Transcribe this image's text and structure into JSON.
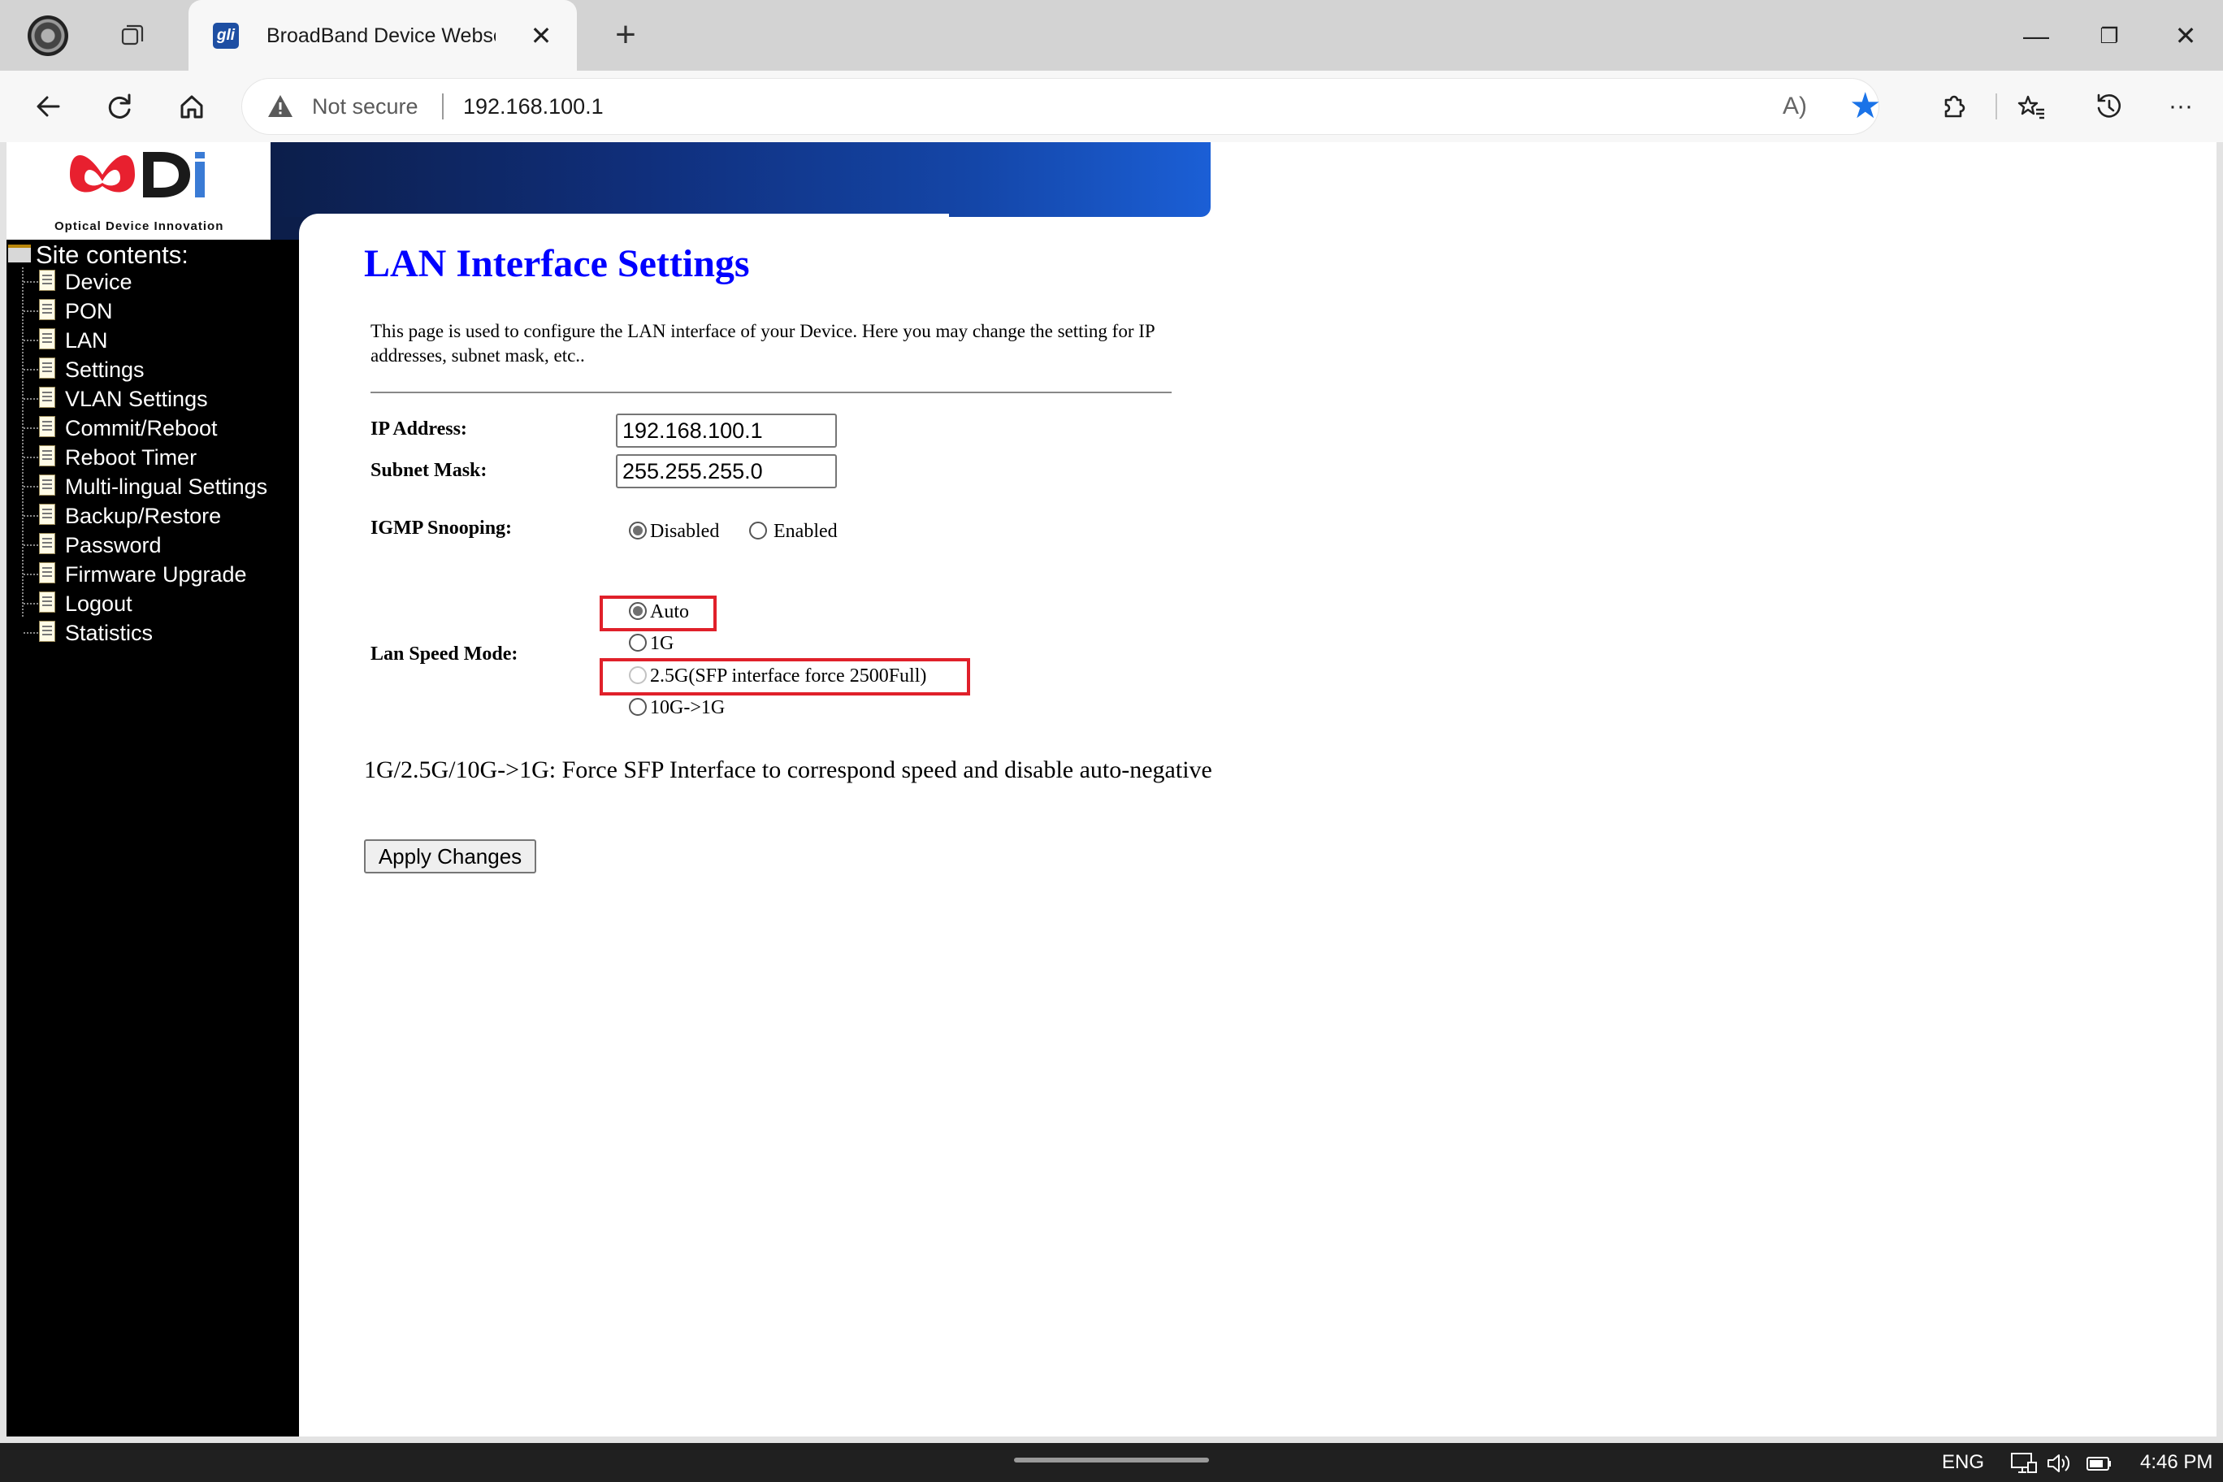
{
  "browser": {
    "tab_title": "BroadBand Device Webserv",
    "tab_favicon_text": "gli",
    "tab_close": "✕",
    "new_tab": "+",
    "security_label": "Not secure",
    "url": "192.168.100.1",
    "read_aloud": "A)",
    "window_controls": {
      "minimize": "—",
      "restore": "❐",
      "close": "✕"
    },
    "icons": [
      "profile-icon",
      "tab-actions-icon",
      "back-icon",
      "refresh-icon",
      "home-icon",
      "warning-icon",
      "read-aloud-icon",
      "favorite-star-icon",
      "extensions-icon",
      "favorites-icon",
      "history-icon",
      "more-icon"
    ],
    "colors": {
      "favorite_star": "#1a73e8",
      "toolbar": "#f7f7f7",
      "tabbar": "#d3d3d3"
    }
  },
  "logo": {
    "text": "Optical Device Innovation",
    "mark": "ODI"
  },
  "sidebar": {
    "title": "Site contents:",
    "items": [
      {
        "label": "Device"
      },
      {
        "label": "PON"
      },
      {
        "label": "LAN"
      },
      {
        "label": "Settings"
      },
      {
        "label": "VLAN Settings"
      },
      {
        "label": "Commit/Reboot"
      },
      {
        "label": "Reboot Timer"
      },
      {
        "label": "Multi-lingual Settings"
      },
      {
        "label": "Backup/Restore"
      },
      {
        "label": "Password"
      },
      {
        "label": "Firmware Upgrade"
      },
      {
        "label": "Logout"
      },
      {
        "label": "Statistics"
      }
    ]
  },
  "main": {
    "title": "LAN Interface Settings",
    "description": "This page is used to configure the LAN interface of your Device. Here you may change the setting for IP addresses, subnet mask, etc..",
    "ip_label": "IP Address:",
    "ip_value": "192.168.100.1",
    "mask_label": "Subnet Mask:",
    "mask_value": "255.255.255.0",
    "igmp_label": "IGMP Snooping:",
    "igmp_options": [
      {
        "label": "Disabled",
        "checked": true
      },
      {
        "label": "Enabled",
        "checked": false
      }
    ],
    "speed_label": "Lan Speed Mode:",
    "speed_options": [
      {
        "label": "Auto",
        "checked": true,
        "highlighted": true
      },
      {
        "label": "1G",
        "checked": false,
        "highlighted": false
      },
      {
        "label": "2.5G(SFP interface force 2500Full)",
        "checked": false,
        "disabled": true,
        "highlighted": true
      },
      {
        "label": "10G->1G",
        "checked": false,
        "highlighted": false
      }
    ],
    "note": "1G/2.5G/10G->1G: Force SFP Interface to correspond speed and disable auto-negative",
    "apply_label": "Apply Changes",
    "colors": {
      "title": "#0000ff",
      "highlight_box": "#e0202a"
    }
  },
  "taskbar": {
    "language": "ENG",
    "time": "4:46 PM",
    "icons": [
      "network-icon",
      "volume-icon",
      "battery-icon"
    ]
  }
}
